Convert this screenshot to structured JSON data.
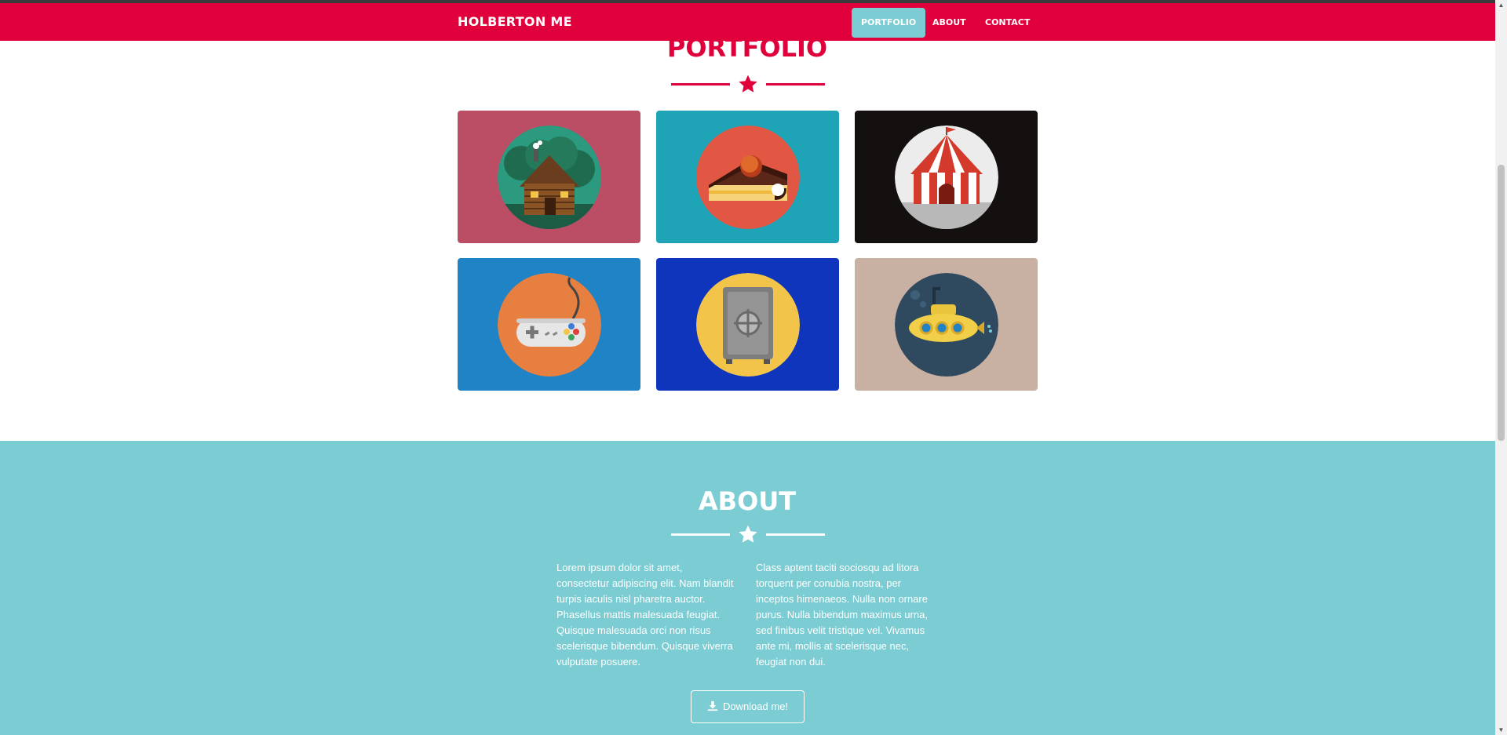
{
  "navbar": {
    "brand": "HOLBERTON ME",
    "items": [
      {
        "label": "PORTFOLIO",
        "active": true
      },
      {
        "label": "ABOUT",
        "active": false
      },
      {
        "label": "CONTACT",
        "active": false
      }
    ]
  },
  "portfolio": {
    "title": "PORTFOLIO",
    "items": [
      {
        "icon": "cabin-icon",
        "bg": "#bb4e65",
        "circle": "#2b9a7f"
      },
      {
        "icon": "cake-icon",
        "bg": "#1fa3b7",
        "circle": "#e15744"
      },
      {
        "icon": "circus-tent-icon",
        "bg": "#151010",
        "circle": "#ececec"
      },
      {
        "icon": "game-controller-icon",
        "bg": "#1f83c5",
        "circle": "#e67f3f"
      },
      {
        "icon": "safe-icon",
        "bg": "#0f35bc",
        "circle": "#f2c54a"
      },
      {
        "icon": "submarine-icon",
        "bg": "#c8b0a2",
        "circle": "#2f4a5e"
      }
    ]
  },
  "about": {
    "title": "ABOUT",
    "paragraph_left": "Lorem ipsum dolor sit amet, consectetur adipiscing elit. Nam blandit turpis iaculis nisl pharetra auctor. Phasellus mattis malesuada feugiat. Quisque malesuada orci non risus scelerisque bibendum. Quisque viverra vulputate posuere.",
    "paragraph_right": "Class aptent taciti sociosqu ad litora torquent per conubia nostra, per inceptos himenaeos. Nulla non ornare purus. Nulla bibendum maximus urna, sed finibus velit tristique vel. Vivamus ante mi, mollis at scelerisque nec, feugiat non dui.",
    "download_label": "Download me!"
  },
  "colors": {
    "primary": "#e0003b",
    "accent": "#7bcdd3",
    "white": "#ffffff"
  }
}
